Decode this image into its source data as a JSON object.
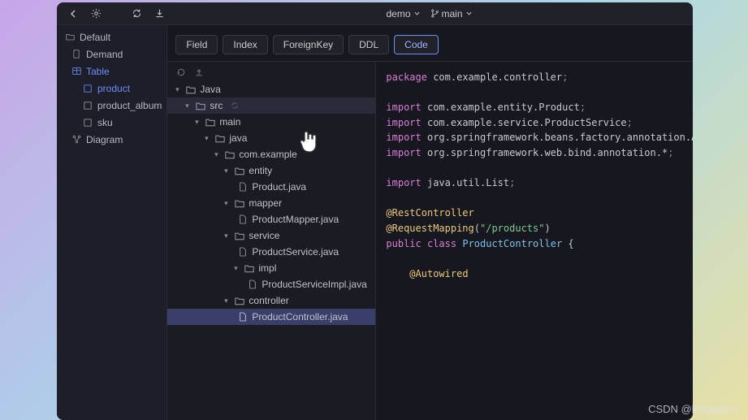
{
  "titlebar": {
    "project": "demo",
    "branch": "main"
  },
  "sidebar": {
    "default": "Default",
    "demand": "Demand",
    "table": "Table",
    "product": "product",
    "product_album": "product_album",
    "sku": "sku",
    "diagram": "Diagram"
  },
  "tabs": {
    "field": "Field",
    "index": "Index",
    "foreignkey": "ForeignKey",
    "ddl": "DDL",
    "code": "Code"
  },
  "tree": {
    "java": "Java",
    "src": "src",
    "main": "main",
    "java2": "java",
    "com_example": "com.example",
    "entity": "entity",
    "product_java": "Product.java",
    "mapper": "mapper",
    "productmapper": "ProductMapper.java",
    "service": "service",
    "productservice": "ProductService.java",
    "impl": "impl",
    "productserviceimpl": "ProductServiceImpl.java",
    "controller": "controller",
    "productcontroller": "ProductController.java"
  },
  "code": {
    "kw_package": "package",
    "pkg_controller": " com.example.controller",
    "kw_import": "import",
    "imp1": " com.example.entity.Product",
    "imp2": " com.example.service.ProductService",
    "imp3": " org.springframework.beans.factory.annotation.Autowired",
    "imp4": " org.springframework.web.bind.annotation.*",
    "imp5": " java.util.List",
    "ann_rest": "@RestController",
    "ann_reqmap": "@RequestMapping",
    "str_products": "\"/products\"",
    "kw_public": "public",
    "kw_class": "class",
    "cls_name": "ProductController",
    "brace_open": " {",
    "ann_autowired": "@Autowired",
    "semi": ";",
    "paren_open": "(",
    "paren_close": ")"
  },
  "watermark": "CSDN @kingapex1"
}
